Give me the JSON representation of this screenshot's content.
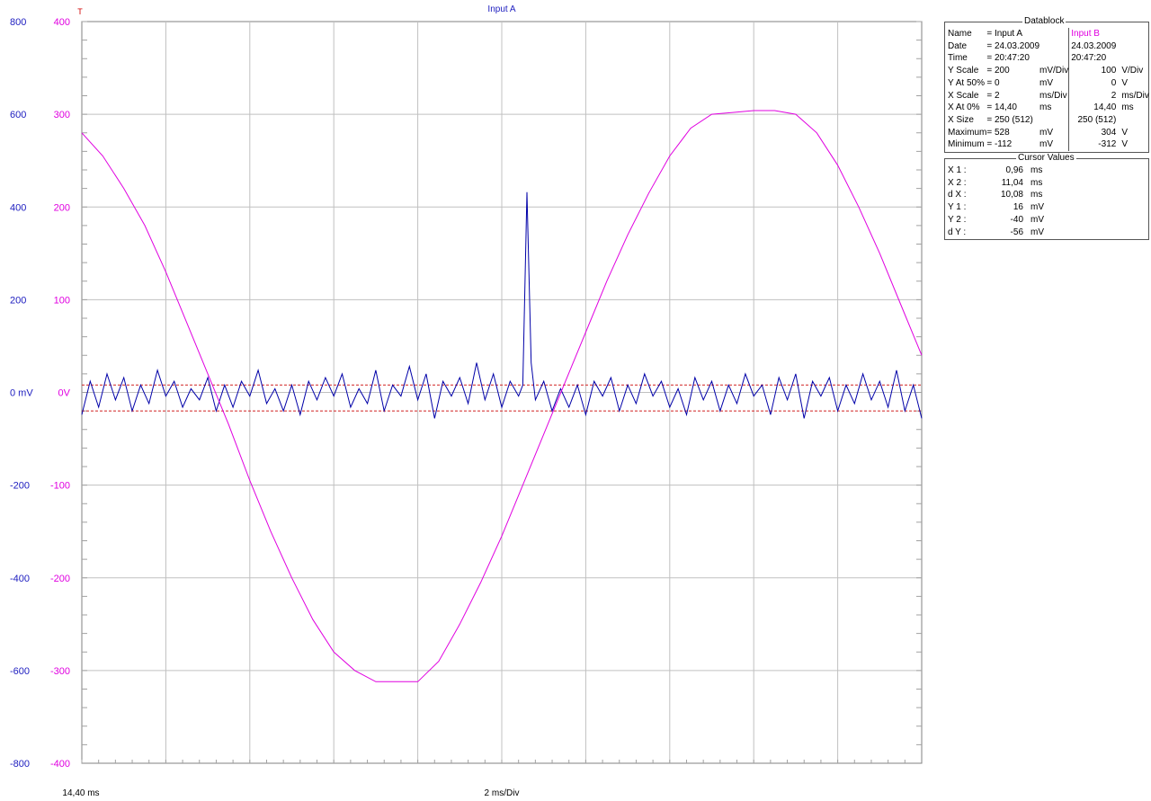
{
  "window": {
    "title": "Input A"
  },
  "colors": {
    "channel_a": "#0000a8",
    "channel_b": "#e000e0",
    "axis_a": "#2020c0",
    "cursor": "#d02020",
    "grid": "#c0c0c0"
  },
  "trigger_marker": "T",
  "axis": {
    "left_ticks_a": [
      "800",
      "600",
      "400",
      "200",
      "0 mV",
      "-200",
      "-400",
      "-600",
      "-800"
    ],
    "left_ticks_b": [
      "400",
      "300",
      "200",
      "100",
      "0V",
      "-100",
      "-200",
      "-300",
      "-400"
    ],
    "x_start_label": "14,40 ms",
    "x_scale_label": "2 ms/Div"
  },
  "datablock": {
    "title": "Datablock",
    "rows": [
      {
        "k": "Name",
        "a_eq": "= Input A",
        "a_unit": "",
        "b_val": "Input B",
        "b_unit": ""
      },
      {
        "k": "Date",
        "a_eq": "= 24.03.2009",
        "a_unit": "",
        "b_val": "24.03.2009",
        "b_unit": ""
      },
      {
        "k": "Time",
        "a_eq": "= 20:47:20",
        "a_unit": "",
        "b_val": "20:47:20",
        "b_unit": ""
      },
      {
        "k": "Y Scale",
        "a_eq": "=    200",
        "a_unit": "mV/Div",
        "b_val": "100",
        "b_unit": "V/Div"
      },
      {
        "k": "Y At 50%",
        "a_eq": "=      0",
        "a_unit": "mV",
        "b_val": "0",
        "b_unit": "V"
      },
      {
        "k": "X Scale",
        "a_eq": "=      2",
        "a_unit": "ms/Div",
        "b_val": "2",
        "b_unit": "ms/Div"
      },
      {
        "k": "X At 0%",
        "a_eq": "=    14,40",
        "a_unit": "ms",
        "b_val": "14,40",
        "b_unit": "ms"
      },
      {
        "k": "X Size",
        "a_eq": "= 250 (512)",
        "a_unit": "",
        "b_val": "250 (512)",
        "b_unit": ""
      },
      {
        "k": "Maximum",
        "a_eq": "=    528",
        "a_unit": "mV",
        "b_val": "304",
        "b_unit": "V"
      },
      {
        "k": "Minimum",
        "a_eq": "=   -112",
        "a_unit": "mV",
        "b_val": "-312",
        "b_unit": "V"
      }
    ]
  },
  "cursor_values": {
    "title": "Cursor Values",
    "rows": [
      {
        "k": "X 1 :",
        "v": "0,96",
        "u": "ms"
      },
      {
        "k": "X 2 :",
        "v": "11,04",
        "u": "ms"
      },
      {
        "k": "d X :",
        "v": "10,08",
        "u": "ms"
      },
      {
        "k": "Y 1 :",
        "v": "16",
        "u": "mV"
      },
      {
        "k": "Y 2 :",
        "v": "-40",
        "u": "mV"
      },
      {
        "k": "d Y :",
        "v": "-56",
        "u": "mV"
      }
    ]
  },
  "chart_data": {
    "type": "line",
    "title": "Input A",
    "xlim_ms": [
      0,
      20
    ],
    "grid": true,
    "y1_unit": "mV",
    "y1lim": [
      -800,
      800
    ],
    "y2_unit": "V",
    "y2lim": [
      -400,
      400
    ],
    "cursors": {
      "y1_mV": 16,
      "y2_mV": -40
    },
    "series": [
      {
        "name": "Input A",
        "axis": "y1",
        "x_ms": [
          0,
          0.2,
          0.4,
          0.6,
          0.8,
          1,
          1.2,
          1.4,
          1.6,
          1.8,
          2,
          2.2,
          2.4,
          2.6,
          2.8,
          3,
          3.2,
          3.4,
          3.6,
          3.8,
          4,
          4.2,
          4.4,
          4.6,
          4.8,
          5,
          5.2,
          5.4,
          5.6,
          5.8,
          6,
          6.2,
          6.4,
          6.6,
          6.8,
          7,
          7.2,
          7.4,
          7.6,
          7.8,
          8,
          8.2,
          8.4,
          8.6,
          8.8,
          9,
          9.2,
          9.4,
          9.6,
          9.8,
          10,
          10.2,
          10.4,
          10.5,
          10.6,
          10.7,
          10.8,
          11,
          11.2,
          11.4,
          11.6,
          11.8,
          12,
          12.2,
          12.4,
          12.6,
          12.8,
          13,
          13.2,
          13.4,
          13.6,
          13.8,
          14,
          14.2,
          14.4,
          14.6,
          14.8,
          15,
          15.2,
          15.4,
          15.6,
          15.8,
          16,
          16.2,
          16.4,
          16.6,
          16.8,
          17,
          17.2,
          17.4,
          17.6,
          17.8,
          18,
          18.2,
          18.4,
          18.6,
          18.8,
          19,
          19.2,
          19.4,
          19.6,
          19.8,
          20
        ],
        "y_mV": [
          -48,
          24,
          -32,
          40,
          -16,
          32,
          -40,
          16,
          -24,
          48,
          -8,
          24,
          -32,
          8,
          -16,
          32,
          -40,
          16,
          -32,
          24,
          -8,
          48,
          -24,
          8,
          -40,
          16,
          -48,
          24,
          -16,
          32,
          -8,
          40,
          -32,
          8,
          -24,
          48,
          -40,
          16,
          -8,
          56,
          -16,
          40,
          -56,
          24,
          -8,
          32,
          -24,
          64,
          -16,
          40,
          -32,
          24,
          -8,
          16,
          432,
          64,
          -16,
          24,
          -40,
          8,
          -32,
          16,
          -48,
          24,
          -8,
          32,
          -40,
          16,
          -24,
          40,
          -8,
          24,
          -32,
          8,
          -48,
          32,
          -16,
          24,
          -40,
          16,
          -24,
          40,
          -8,
          16,
          -48,
          32,
          -16,
          40,
          -56,
          24,
          -8,
          32,
          -40,
          16,
          -24,
          40,
          -16,
          24,
          -32,
          48,
          -40,
          16,
          -56
        ]
      },
      {
        "name": "Input B",
        "axis": "y2",
        "x_ms": [
          0,
          0.5,
          1,
          1.5,
          2,
          2.5,
          3,
          3.5,
          4,
          4.5,
          5,
          5.5,
          6,
          6.5,
          7,
          7.5,
          8,
          8.5,
          9,
          9.5,
          10,
          10.5,
          11,
          11.5,
          12,
          12.5,
          13,
          13.5,
          14,
          14.5,
          15,
          15.5,
          16,
          16.5,
          17,
          17.5,
          18,
          18.5,
          19,
          19.5,
          20
        ],
        "y_V": [
          280,
          255,
          220,
          180,
          130,
          75,
          20,
          -35,
          -95,
          -150,
          -200,
          -245,
          -280,
          -300,
          -312,
          -312,
          -312,
          -290,
          -250,
          -205,
          -155,
          -100,
          -45,
          10,
          65,
          120,
          170,
          215,
          255,
          285,
          300,
          302,
          304,
          304,
          300,
          280,
          245,
          200,
          150,
          95,
          40
        ]
      }
    ]
  }
}
